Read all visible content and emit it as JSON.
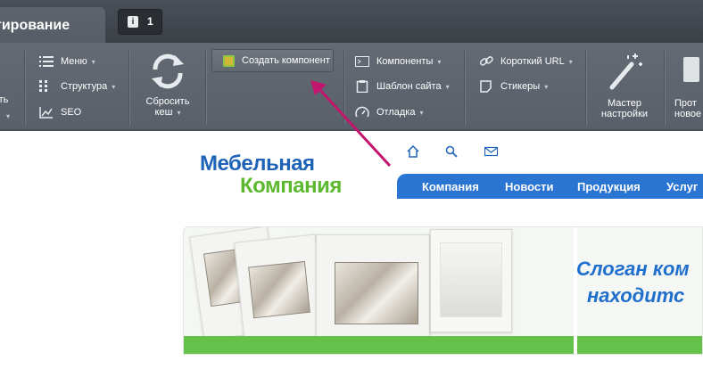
{
  "topbar": {
    "mode_tab_label": "тирование",
    "notification_count": "1"
  },
  "toolbar": {
    "left_partial_label": "ть",
    "menu_label": "Меню",
    "structure_label": "Структура",
    "seo_label": "SEO",
    "reset_cache_label_line1": "Сбросить",
    "reset_cache_label_line2": "кеш",
    "create_component_label": "Создать компонент",
    "components_label": "Компоненты",
    "site_template_label": "Шаблон сайта",
    "debug_label": "Отладка",
    "short_url_label": "Короткий URL",
    "stickers_label": "Стикеры",
    "wizard_label_line1": "Мастер",
    "wizard_label_line2": "настройки",
    "right_partial_line1": "Прот",
    "right_partial_line2": "новое"
  },
  "site": {
    "logo_line1": "Мебельная",
    "logo_line2": "Компания",
    "nav": [
      "Компания",
      "Новости",
      "Продукция",
      "Услуг"
    ],
    "slogan_line1": "Слоган ком",
    "slogan_line2": "находитс"
  },
  "colors": {
    "arrow": "#c2156e",
    "nav_blue": "#2a74d2",
    "logo_blue": "#1e63b7",
    "logo_green": "#5cb82e",
    "banner_green": "#64c24a"
  },
  "icons": {
    "home": "home-icon",
    "search": "search-icon",
    "mail": "mail-icon",
    "reset": "refresh-icon",
    "wand": "magic-wand-icon"
  }
}
